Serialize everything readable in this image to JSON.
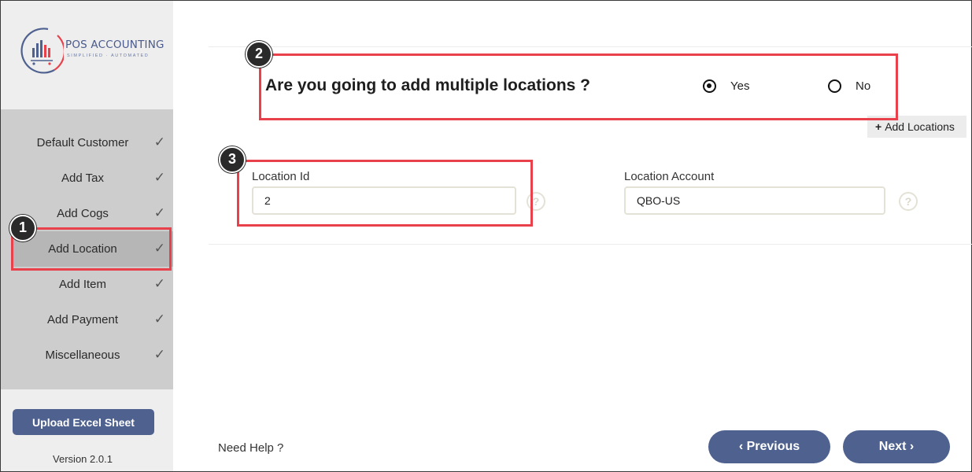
{
  "brand": {
    "name": "POS ACCOUNTING",
    "tagline": "SIMPLIFIED · AUTOMATED",
    "colors": {
      "primary": "#4e618f",
      "accent": "#e8414b"
    }
  },
  "sidebar": {
    "steps": [
      {
        "label": "Default Customer",
        "done": true
      },
      {
        "label": "Add Tax",
        "done": true
      },
      {
        "label": "Add Cogs",
        "done": true
      },
      {
        "label": "Add Location",
        "done": true,
        "active": true
      },
      {
        "label": "Add Item",
        "done": true
      },
      {
        "label": "Add Payment",
        "done": true
      },
      {
        "label": "Miscellaneous",
        "done": true
      }
    ],
    "check_glyph": "✓",
    "upload_label": "Upload Excel Sheet",
    "version": "Version 2.0.1"
  },
  "main": {
    "question": "Are you going to add multiple locations ?",
    "options": [
      {
        "label": "Yes",
        "selected": true
      },
      {
        "label": "No",
        "selected": false
      }
    ],
    "add_locations_label": "Add Locations",
    "add_locations_icon": "+",
    "fields": [
      {
        "label": "Location Id",
        "value": "2"
      },
      {
        "label": "Location Account",
        "value": "QBO-US"
      }
    ],
    "help_glyph": "?"
  },
  "footer": {
    "need_help": "Need Help ?",
    "previous_label": "‹  Previous",
    "next_label": "Next  ›"
  },
  "annotations": {
    "badges": [
      "1",
      "2",
      "3"
    ]
  }
}
